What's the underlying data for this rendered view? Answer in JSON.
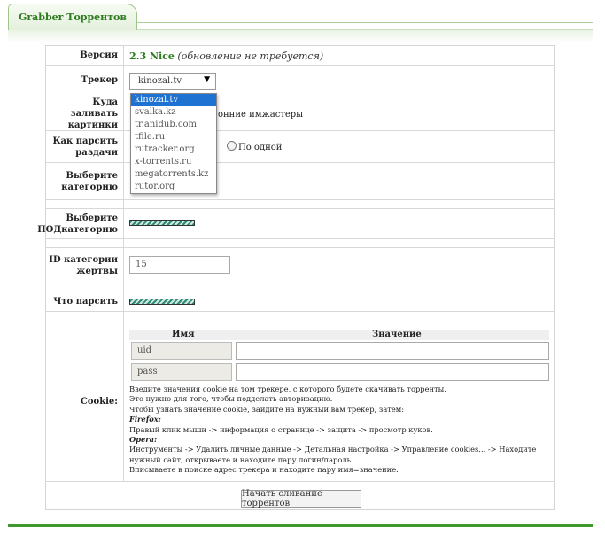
{
  "tab": {
    "title": "Grabber Торрентов"
  },
  "version": {
    "label": "Версия",
    "number": "2.3 Nice",
    "note": "(обновление не требуется)"
  },
  "tracker": {
    "label": "Трекер",
    "selected": "kinozal.tv",
    "options": [
      "kinozal.tv",
      "svalka.kz",
      "tr.anidub.com",
      "tfile.ru",
      "rutracker.org",
      "x-torrents.ru",
      "megatorrents.kz",
      "rutor.org"
    ]
  },
  "upload": {
    "label": "Куда заливать картинки",
    "visible_text": "онние имжастеры"
  },
  "parse_mode": {
    "label": "Как парсить раздачи",
    "option": "По одной"
  },
  "category": {
    "label": "Выберите категорию"
  },
  "subcategory": {
    "label": "Выберите ПОДкатегорию"
  },
  "victim_id": {
    "label": "ID категории жертвы",
    "value": "15"
  },
  "what_parse": {
    "label": "Что парсить"
  },
  "cookie": {
    "label": "Cookie:",
    "col_name": "Имя",
    "col_value": "Значение",
    "rows": [
      {
        "name": "uid",
        "value": ""
      },
      {
        "name": "pass",
        "value": ""
      }
    ],
    "instructions": [
      "Введите значения cookie на том трекере, с которого будете скачивать торренты.",
      "Это нужно для того, чтобы подделать авторизацию.",
      "Чтобы узнать значение cookie, зайдите на нужный вам трекер, затем:"
    ],
    "firefox_label": "Firefox:",
    "firefox_steps": "Правый клик мыши -> информация о странице -> защита -> просмотр куков.",
    "opera_label": "Opera:",
    "opera_steps": "Инструменты -> Удалить личные данные -> Детальная настройка -> Управление cookies... -> Находите нужный сайт, открываете и находите пару логин/пароль.",
    "final_step": "Вписываете в поиске адрес трекера и находите пару имя=значение."
  },
  "submit": {
    "label": "Начать сливание торрентов"
  }
}
